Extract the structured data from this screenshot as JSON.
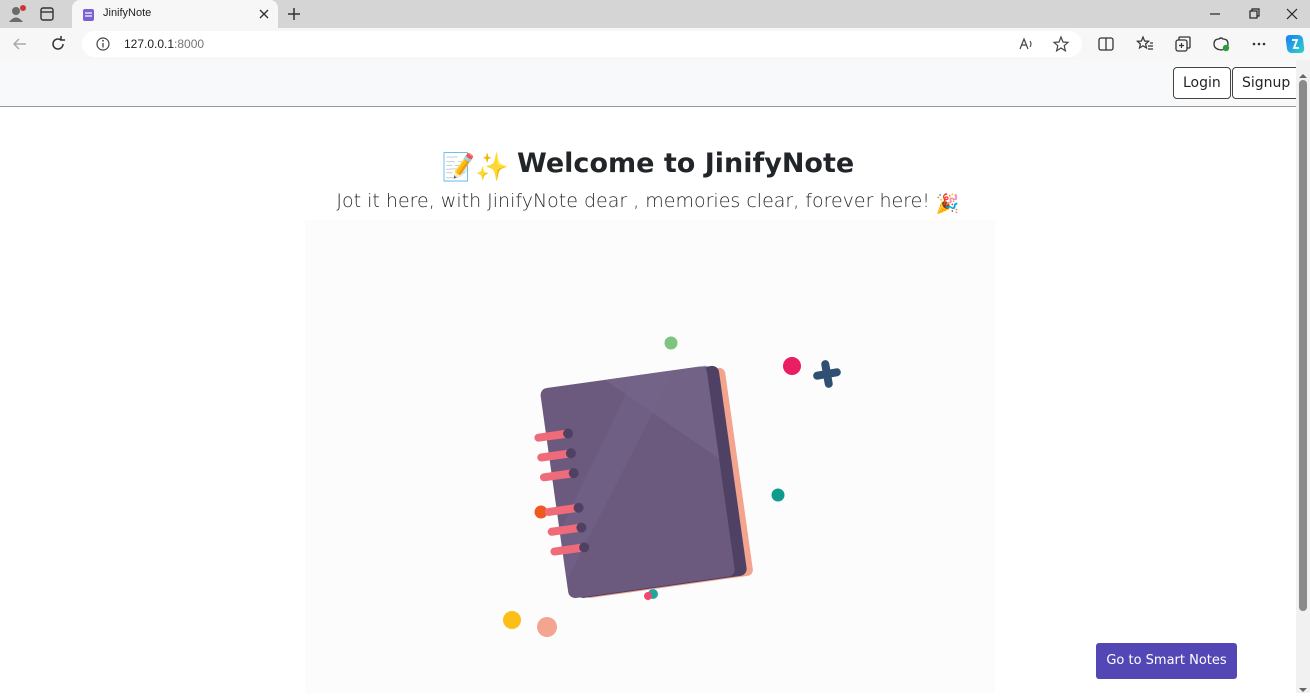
{
  "browser": {
    "tab_title": "JinifyNote",
    "url_host": "127.0.0.1",
    "url_port": ":8000"
  },
  "nav": {
    "login_label": "Login",
    "signup_label": "Signup"
  },
  "hero": {
    "title": "Welcome to JinifyNote",
    "title_emojis": "📝✨",
    "subtitle": "Jot it here, with JinifyNote dear , memories clear, forever here!",
    "subtitle_emoji": "🎉"
  },
  "cta": {
    "label": "Go to Smart Notes"
  },
  "colors": {
    "cta_bg": "#5347b5",
    "notebook_cover": "#6b5a7e",
    "notebook_edge": "#f2a48e",
    "rings": "#f06b7a"
  },
  "icons": [
    "profile-icon",
    "tab-actions-icon",
    "notes-favicon",
    "close-icon",
    "plus-icon",
    "minimize-icon",
    "restore-icon",
    "back-icon",
    "refresh-icon",
    "info-icon",
    "read-aloud-icon",
    "star-icon",
    "split-screen-icon",
    "favorites-icon",
    "collections-icon",
    "shield-icon",
    "more-icon",
    "copilot-icon"
  ]
}
